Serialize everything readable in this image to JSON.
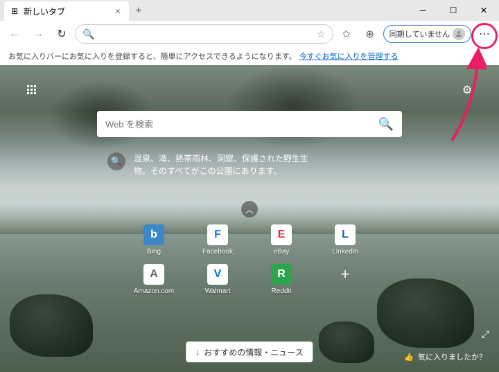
{
  "titlebar": {
    "tab_title": "新しいタブ",
    "tab_icon": "⊞"
  },
  "toolbar": {
    "sync_label": "同期していません"
  },
  "fav_bar": {
    "text": "お気に入りバーにお気に入りを登録すると、簡単にアクセスできるようになります。",
    "link": "今すぐお気に入りを管理する"
  },
  "search": {
    "placeholder": "Web を検索"
  },
  "promo": {
    "text": "温泉、滝、熱帯雨林、洞窟、保護された野生生物。そのすべてがこの公園にあります。"
  },
  "tiles": [
    {
      "label": "Bing",
      "letter": "b",
      "bg": "#3b87c8",
      "fg": "#fff"
    },
    {
      "label": "Facebook",
      "letter": "F",
      "bg": "#ffffff",
      "fg": "#1877f2"
    },
    {
      "label": "eBay",
      "letter": "E",
      "bg": "#ffffff",
      "fg": "#e53238"
    },
    {
      "label": "Linkedin",
      "letter": "L",
      "bg": "#ffffff",
      "fg": "#0a66c2"
    },
    {
      "label": "Amazon.com",
      "letter": "A",
      "bg": "#ffffff",
      "fg": "#666"
    },
    {
      "label": "Walmart",
      "letter": "V",
      "bg": "#ffffff",
      "fg": "#0071ce"
    },
    {
      "label": "Reddit",
      "letter": "R",
      "bg": "#2da44e",
      "fg": "#fff"
    }
  ],
  "news_label": "おすすめの情報・ニュース",
  "like_label": "気に入りましたか？"
}
